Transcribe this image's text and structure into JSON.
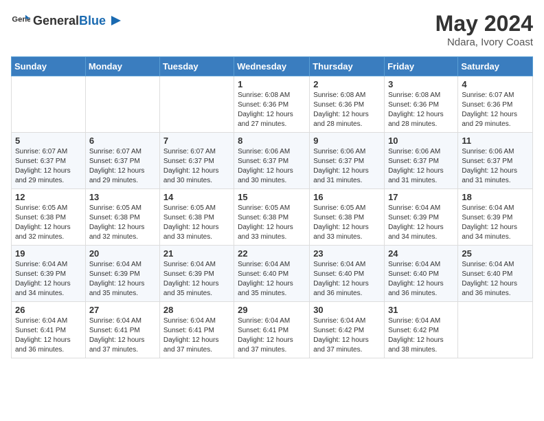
{
  "header": {
    "logo_general": "General",
    "logo_blue": "Blue",
    "month_year": "May 2024",
    "location": "Ndara, Ivory Coast"
  },
  "days_of_week": [
    "Sunday",
    "Monday",
    "Tuesday",
    "Wednesday",
    "Thursday",
    "Friday",
    "Saturday"
  ],
  "weeks": [
    [
      {
        "day": "",
        "info": ""
      },
      {
        "day": "",
        "info": ""
      },
      {
        "day": "",
        "info": ""
      },
      {
        "day": "1",
        "info": "Sunrise: 6:08 AM\nSunset: 6:36 PM\nDaylight: 12 hours\nand 27 minutes."
      },
      {
        "day": "2",
        "info": "Sunrise: 6:08 AM\nSunset: 6:36 PM\nDaylight: 12 hours\nand 28 minutes."
      },
      {
        "day": "3",
        "info": "Sunrise: 6:08 AM\nSunset: 6:36 PM\nDaylight: 12 hours\nand 28 minutes."
      },
      {
        "day": "4",
        "info": "Sunrise: 6:07 AM\nSunset: 6:36 PM\nDaylight: 12 hours\nand 29 minutes."
      }
    ],
    [
      {
        "day": "5",
        "info": "Sunrise: 6:07 AM\nSunset: 6:37 PM\nDaylight: 12 hours\nand 29 minutes."
      },
      {
        "day": "6",
        "info": "Sunrise: 6:07 AM\nSunset: 6:37 PM\nDaylight: 12 hours\nand 29 minutes."
      },
      {
        "day": "7",
        "info": "Sunrise: 6:07 AM\nSunset: 6:37 PM\nDaylight: 12 hours\nand 30 minutes."
      },
      {
        "day": "8",
        "info": "Sunrise: 6:06 AM\nSunset: 6:37 PM\nDaylight: 12 hours\nand 30 minutes."
      },
      {
        "day": "9",
        "info": "Sunrise: 6:06 AM\nSunset: 6:37 PM\nDaylight: 12 hours\nand 31 minutes."
      },
      {
        "day": "10",
        "info": "Sunrise: 6:06 AM\nSunset: 6:37 PM\nDaylight: 12 hours\nand 31 minutes."
      },
      {
        "day": "11",
        "info": "Sunrise: 6:06 AM\nSunset: 6:37 PM\nDaylight: 12 hours\nand 31 minutes."
      }
    ],
    [
      {
        "day": "12",
        "info": "Sunrise: 6:05 AM\nSunset: 6:38 PM\nDaylight: 12 hours\nand 32 minutes."
      },
      {
        "day": "13",
        "info": "Sunrise: 6:05 AM\nSunset: 6:38 PM\nDaylight: 12 hours\nand 32 minutes."
      },
      {
        "day": "14",
        "info": "Sunrise: 6:05 AM\nSunset: 6:38 PM\nDaylight: 12 hours\nand 33 minutes."
      },
      {
        "day": "15",
        "info": "Sunrise: 6:05 AM\nSunset: 6:38 PM\nDaylight: 12 hours\nand 33 minutes."
      },
      {
        "day": "16",
        "info": "Sunrise: 6:05 AM\nSunset: 6:38 PM\nDaylight: 12 hours\nand 33 minutes."
      },
      {
        "day": "17",
        "info": "Sunrise: 6:04 AM\nSunset: 6:39 PM\nDaylight: 12 hours\nand 34 minutes."
      },
      {
        "day": "18",
        "info": "Sunrise: 6:04 AM\nSunset: 6:39 PM\nDaylight: 12 hours\nand 34 minutes."
      }
    ],
    [
      {
        "day": "19",
        "info": "Sunrise: 6:04 AM\nSunset: 6:39 PM\nDaylight: 12 hours\nand 34 minutes."
      },
      {
        "day": "20",
        "info": "Sunrise: 6:04 AM\nSunset: 6:39 PM\nDaylight: 12 hours\nand 35 minutes."
      },
      {
        "day": "21",
        "info": "Sunrise: 6:04 AM\nSunset: 6:39 PM\nDaylight: 12 hours\nand 35 minutes."
      },
      {
        "day": "22",
        "info": "Sunrise: 6:04 AM\nSunset: 6:40 PM\nDaylight: 12 hours\nand 35 minutes."
      },
      {
        "day": "23",
        "info": "Sunrise: 6:04 AM\nSunset: 6:40 PM\nDaylight: 12 hours\nand 36 minutes."
      },
      {
        "day": "24",
        "info": "Sunrise: 6:04 AM\nSunset: 6:40 PM\nDaylight: 12 hours\nand 36 minutes."
      },
      {
        "day": "25",
        "info": "Sunrise: 6:04 AM\nSunset: 6:40 PM\nDaylight: 12 hours\nand 36 minutes."
      }
    ],
    [
      {
        "day": "26",
        "info": "Sunrise: 6:04 AM\nSunset: 6:41 PM\nDaylight: 12 hours\nand 36 minutes."
      },
      {
        "day": "27",
        "info": "Sunrise: 6:04 AM\nSunset: 6:41 PM\nDaylight: 12 hours\nand 37 minutes."
      },
      {
        "day": "28",
        "info": "Sunrise: 6:04 AM\nSunset: 6:41 PM\nDaylight: 12 hours\nand 37 minutes."
      },
      {
        "day": "29",
        "info": "Sunrise: 6:04 AM\nSunset: 6:41 PM\nDaylight: 12 hours\nand 37 minutes."
      },
      {
        "day": "30",
        "info": "Sunrise: 6:04 AM\nSunset: 6:42 PM\nDaylight: 12 hours\nand 37 minutes."
      },
      {
        "day": "31",
        "info": "Sunrise: 6:04 AM\nSunset: 6:42 PM\nDaylight: 12 hours\nand 38 minutes."
      },
      {
        "day": "",
        "info": ""
      }
    ]
  ]
}
